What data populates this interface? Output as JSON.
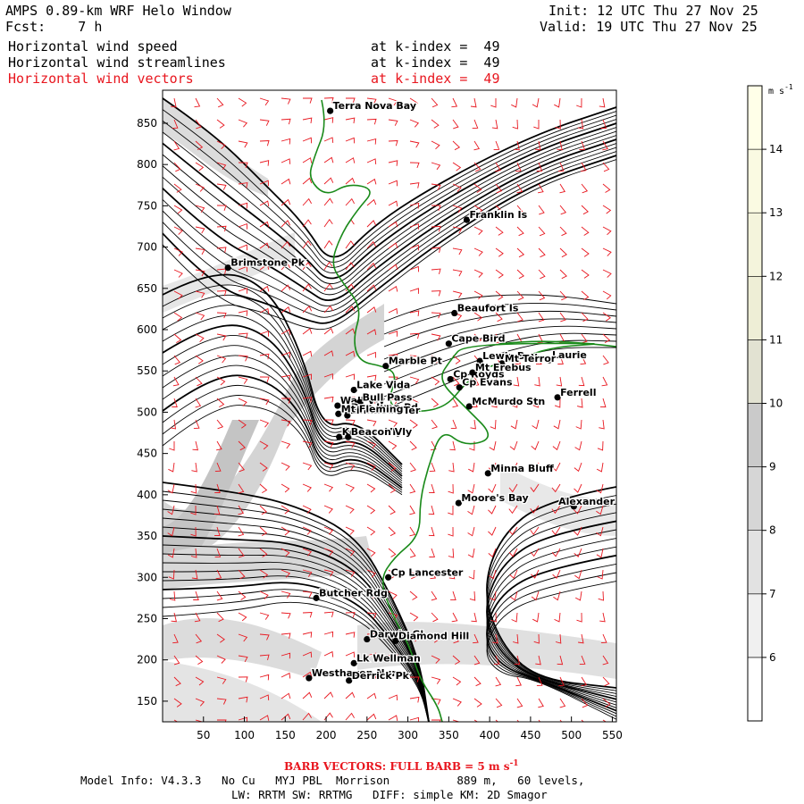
{
  "header": {
    "title": "AMPS 0.89-km WRF Helo Window",
    "fcst_label": "Fcst:",
    "fcst_value": "7 h",
    "init": "Init: 12 UTC Thu 27 Nov 25",
    "valid": "Valid: 19 UTC Thu 27 Nov 25",
    "fields": [
      {
        "name": "Horizontal wind speed",
        "level": "at k-index =  49",
        "color": "#000000"
      },
      {
        "name": "Horizontal wind streamlines",
        "level": "at k-index =  49",
        "color": "#000000"
      },
      {
        "name": "Horizontal wind vectors",
        "level": "at k-index =  49",
        "color": "#e8161e"
      }
    ]
  },
  "map": {
    "x_ticks": [
      50,
      100,
      150,
      200,
      250,
      300,
      350,
      400,
      450,
      500,
      550
    ],
    "y_ticks": [
      150,
      200,
      250,
      300,
      350,
      400,
      450,
      500,
      550,
      600,
      650,
      700,
      750,
      800,
      850
    ],
    "xlim": [
      0,
      555
    ],
    "ylim": [
      125,
      890
    ],
    "coast_color": "#1a8a1a",
    "vector_color": "#e8161e",
    "places": [
      {
        "name": "Terra Nova Bay",
        "x": 205,
        "y": 865
      },
      {
        "name": "Franklin Is",
        "x": 372,
        "y": 733
      },
      {
        "name": "Brimstone Pk",
        "x": 80,
        "y": 675
      },
      {
        "name": "Beaufort Is",
        "x": 357,
        "y": 620
      },
      {
        "name": "Cape Bird",
        "x": 350,
        "y": 583
      },
      {
        "name": "Lewis Bay",
        "x": 388,
        "y": 562
      },
      {
        "name": "Laurie",
        "x": 473,
        "y": 563
      },
      {
        "name": "Marble Pt",
        "x": 273,
        "y": 556
      },
      {
        "name": "Mt Terror",
        "x": 415,
        "y": 559
      },
      {
        "name": "Cp Royds",
        "x": 352,
        "y": 540
      },
      {
        "name": "Mt Erebus",
        "x": 379,
        "y": 548
      },
      {
        "name": "Lake Vida",
        "x": 234,
        "y": 527
      },
      {
        "name": "Cp Evans",
        "x": 363,
        "y": 530
      },
      {
        "name": "Ferrell",
        "x": 483,
        "y": 518
      },
      {
        "name": "Wall Vly",
        "x": 214,
        "y": 508
      },
      {
        "name": "Bull Pass",
        "x": 241,
        "y": 512
      },
      {
        "name": "McMurdo Stn",
        "x": 375,
        "y": 507
      },
      {
        "name": "Don Juan Pd",
        "x": 227,
        "y": 500
      },
      {
        "name": "Linnaeus Ter",
        "x": 226,
        "y": 496
      },
      {
        "name": "Mt Fleming",
        "x": 215,
        "y": 498
      },
      {
        "name": "Kennar Vly",
        "x": 216,
        "y": 470
      },
      {
        "name": "Beacon Vly",
        "x": 227,
        "y": 470
      },
      {
        "name": "Minna Bluff",
        "x": 398,
        "y": 426
      },
      {
        "name": "Moore's Bay",
        "x": 362,
        "y": 390
      },
      {
        "name": "Alexander",
        "x": 503,
        "y": 386
      },
      {
        "name": "Cp Lancester",
        "x": 276,
        "y": 300
      },
      {
        "name": "Butcher Rdg",
        "x": 188,
        "y": 275
      },
      {
        "name": "Darwin Gl",
        "x": 250,
        "y": 225
      },
      {
        "name": "Diamond Hill",
        "x": 285,
        "y": 223
      },
      {
        "name": "Lk Wellman",
        "x": 234,
        "y": 196
      },
      {
        "name": "Westhaven Nun",
        "x": 179,
        "y": 178
      },
      {
        "name": "Derrick Pk",
        "x": 228,
        "y": 175
      }
    ]
  },
  "colorbar": {
    "unit": "m s",
    "unit_exp": "-1",
    "labels": [
      6,
      7,
      8,
      9,
      10,
      11,
      12,
      13,
      14
    ],
    "min": 5,
    "max": 15,
    "colors": [
      "#ffffff",
      "#f0f0f0",
      "#e2e2e2",
      "#d6d6d6",
      "#cacaca",
      "#e2e2d2",
      "#eeeed6",
      "#f4f4dc",
      "#fafae2",
      "#ffffe8"
    ]
  },
  "footer": {
    "barb_note": "BARB VECTORS: FULL BARB = 5 m s",
    "barb_exp": "-1",
    "line1": "Model Info: V4.3.3   No Cu   MYJ PBL  Morrison          889 m,   60 levels,",
    "line2": "LW: RRTM SW: RRTMG   DIFF: simple KM: 2D Smagor"
  }
}
